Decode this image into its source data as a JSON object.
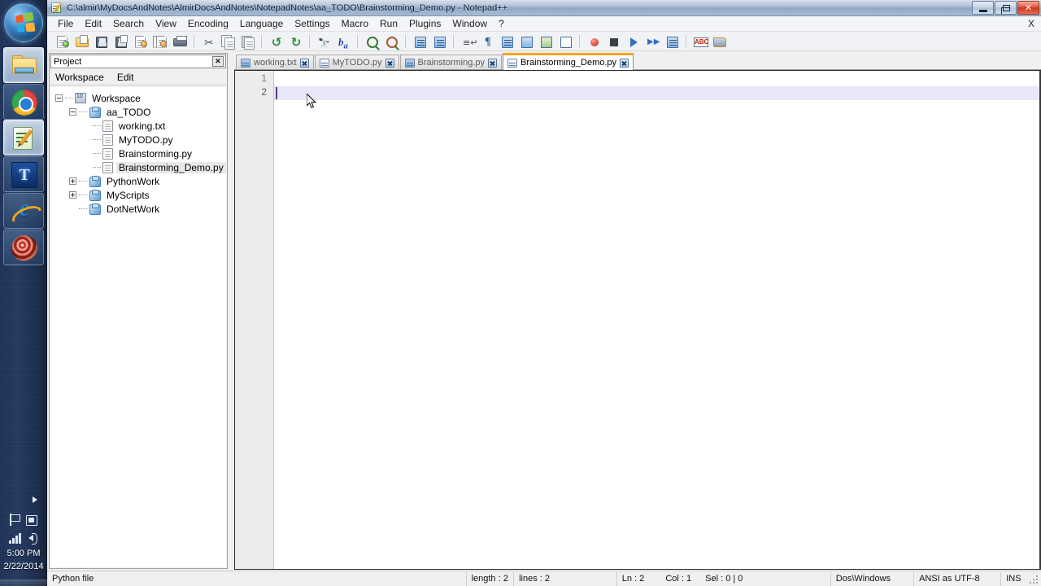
{
  "taskbar": {
    "start_button": "Start",
    "items": [
      {
        "name": "windows-explorer",
        "icon": "folder-icon",
        "state": "pinned"
      },
      {
        "name": "google-chrome",
        "icon": "chrome-icon",
        "state": "pinned"
      },
      {
        "name": "notepad-plus-plus",
        "icon": "notepad-plus-plus-icon",
        "state": "active"
      },
      {
        "name": "blue-t-app",
        "icon": "t-app-icon",
        "state": "running"
      },
      {
        "name": "internet-explorer",
        "icon": "internet-explorer-icon",
        "state": "running"
      },
      {
        "name": "red-target-app",
        "icon": "target-icon",
        "state": "running"
      }
    ],
    "tray": {
      "show_hidden": "show-hidden-icons",
      "action_center": "flag-icon",
      "network_device": "device-icon",
      "signal": "signal-bars-icon",
      "volume": "speaker-icon",
      "time": "5:00 PM",
      "date": "2/22/2014"
    }
  },
  "window": {
    "title": "C:\\almir\\MyDocsAndNotes\\AlmirDocsAndNotes\\NotepadNotes\\aa_TODO\\Brainstorming_Demo.py - Notepad++",
    "app_icon": "notepad-plus-plus-icon",
    "controls": {
      "minimize": "minimize-icon",
      "restore": "restore-icon",
      "close": "close-icon"
    }
  },
  "menubar": {
    "items": [
      "File",
      "Edit",
      "Search",
      "View",
      "Encoding",
      "Language",
      "Settings",
      "Macro",
      "Run",
      "Plugins",
      "Window",
      "?"
    ],
    "close_document": "X"
  },
  "toolbar": {
    "buttons": [
      {
        "name": "new-file-button",
        "icon": "new-document-icon"
      },
      {
        "name": "open-file-button",
        "icon": "open-folder-icon"
      },
      {
        "name": "save-button",
        "icon": "floppy-disk-icon"
      },
      {
        "name": "save-all-button",
        "icon": "save-all-icon"
      },
      {
        "name": "close-button",
        "icon": "close-document-icon"
      },
      {
        "name": "close-all-button",
        "icon": "close-all-documents-icon"
      },
      {
        "name": "print-button",
        "icon": "printer-icon"
      },
      {
        "name": "cut-button",
        "icon": "scissors-icon"
      },
      {
        "name": "copy-button",
        "icon": "copy-icon"
      },
      {
        "name": "paste-button",
        "icon": "paste-icon"
      },
      {
        "name": "undo-button",
        "icon": "undo-arrow-icon"
      },
      {
        "name": "redo-button",
        "icon": "redo-arrow-icon"
      },
      {
        "name": "find-button",
        "icon": "binoculars-icon"
      },
      {
        "name": "replace-button",
        "icon": "replace-ab-icon"
      },
      {
        "name": "zoom-in-button",
        "icon": "zoom-in-icon"
      },
      {
        "name": "zoom-out-button",
        "icon": "zoom-out-icon"
      },
      {
        "name": "sync-vertical-button",
        "icon": "sync-vertical-icon"
      },
      {
        "name": "sync-horizontal-button",
        "icon": "sync-horizontal-icon"
      },
      {
        "name": "word-wrap-button",
        "icon": "word-wrap-icon"
      },
      {
        "name": "show-all-chars-button",
        "icon": "pilcrow-icon"
      },
      {
        "name": "indent-guide-button",
        "icon": "indent-guide-icon"
      },
      {
        "name": "user-defined-dialog-button",
        "icon": "user-language-icon"
      },
      {
        "name": "document-map-button",
        "icon": "document-map-icon"
      },
      {
        "name": "function-list-button",
        "icon": "function-list-icon"
      },
      {
        "name": "record-macro-button",
        "icon": "record-icon"
      },
      {
        "name": "stop-recording-button",
        "icon": "stop-icon"
      },
      {
        "name": "play-macro-button",
        "icon": "play-icon"
      },
      {
        "name": "run-macro-multiple-button",
        "icon": "fast-forward-icon"
      },
      {
        "name": "save-macro-button",
        "icon": "save-macro-icon"
      },
      {
        "name": "spell-check-button",
        "icon": "abc-spellcheck-icon"
      },
      {
        "name": "run-button",
        "icon": "run-console-icon"
      }
    ]
  },
  "project_panel": {
    "title": "Project",
    "close_label": "x",
    "menu": [
      "Workspace",
      "Edit"
    ],
    "tree": [
      {
        "label": "Workspace",
        "depth": 0,
        "icon": "workspace-icon",
        "expander": "minus",
        "selected": false
      },
      {
        "label": "aa_TODO",
        "depth": 1,
        "icon": "project-cube-icon",
        "expander": "minus",
        "selected": false
      },
      {
        "label": "working.txt",
        "depth": 2,
        "icon": "file-icon",
        "expander": "none",
        "selected": false
      },
      {
        "label": "MyTODO.py",
        "depth": 2,
        "icon": "file-icon",
        "expander": "none",
        "selected": false
      },
      {
        "label": "Brainstorming.py",
        "depth": 2,
        "icon": "file-icon",
        "expander": "none",
        "selected": false
      },
      {
        "label": "Brainstorming_Demo.py",
        "depth": 2,
        "icon": "file-icon",
        "expander": "none",
        "selected": true
      },
      {
        "label": "PythonWork",
        "depth": 1,
        "icon": "project-cube-icon",
        "expander": "plus",
        "selected": false
      },
      {
        "label": "MyScripts",
        "depth": 1,
        "icon": "project-cube-icon",
        "expander": "plus",
        "selected": false
      },
      {
        "label": "DotNetWork",
        "depth": 1,
        "icon": "project-cube-icon",
        "expander": "none",
        "selected": false
      }
    ]
  },
  "tabs": [
    {
      "label": "working.txt",
      "icon": "text-file-icon",
      "active": false
    },
    {
      "label": "MyTODO.py",
      "icon": "python-file-icon",
      "active": false
    },
    {
      "label": "Brainstorming.py",
      "icon": "python-file-icon",
      "active": false
    },
    {
      "label": "Brainstorming_Demo.py",
      "icon": "python-file-icon",
      "active": true
    }
  ],
  "editor": {
    "line_numbers": [
      "1",
      "2"
    ],
    "lines": [
      "",
      ""
    ],
    "current_line": 2,
    "accent_active_tab": "#f6a623",
    "current_line_highlight": "#e8e8f8"
  },
  "statusbar": {
    "file_type": "Python file",
    "length": "length : 2",
    "lines": "lines : 2",
    "ln": "Ln : 2",
    "col": "Col : 1",
    "sel": "Sel : 0 | 0",
    "eol": "Dos\\Windows",
    "encoding": "ANSI as UTF-8",
    "insert_mode": "INS"
  }
}
